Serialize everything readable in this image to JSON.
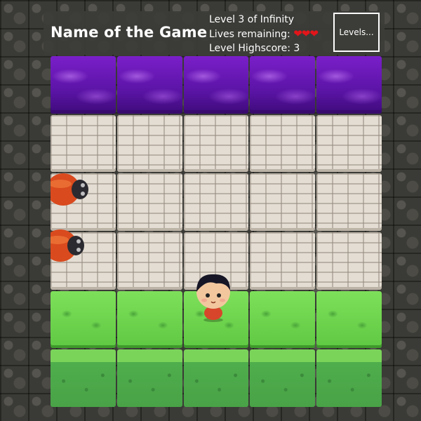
{
  "header": {
    "title": "Name of the Game",
    "level_text": "Level 3 of Infinity",
    "lives_label": "Lives remaining:",
    "lives": 3,
    "hearts": "❤❤❤",
    "highscore_text": "Level Highscore: 3",
    "levels_button": "Levels..."
  },
  "board": {
    "rows": [
      [
        "water",
        "water",
        "water",
        "water",
        "water"
      ],
      [
        "stone",
        "stone",
        "stone",
        "stone",
        "stone"
      ],
      [
        "stone",
        "stone",
        "stone",
        "stone",
        "stone"
      ],
      [
        "stone",
        "stone",
        "stone",
        "stone",
        "stone"
      ],
      [
        "grass",
        "grass",
        "grass",
        "grass",
        "grass"
      ],
      [
        "dirt",
        "dirt",
        "dirt",
        "dirt",
        "dirt"
      ]
    ]
  },
  "sprites": {
    "player_icon": "player-character",
    "enemy_icon": "ladybug-enemy",
    "enemy_count": 2
  },
  "colors": {
    "water": "#6a1bb8",
    "stone": "#e4ddd3",
    "grass": "#6ad24d",
    "heart": "#e3151a",
    "enemy_body": "#d94a1e"
  }
}
